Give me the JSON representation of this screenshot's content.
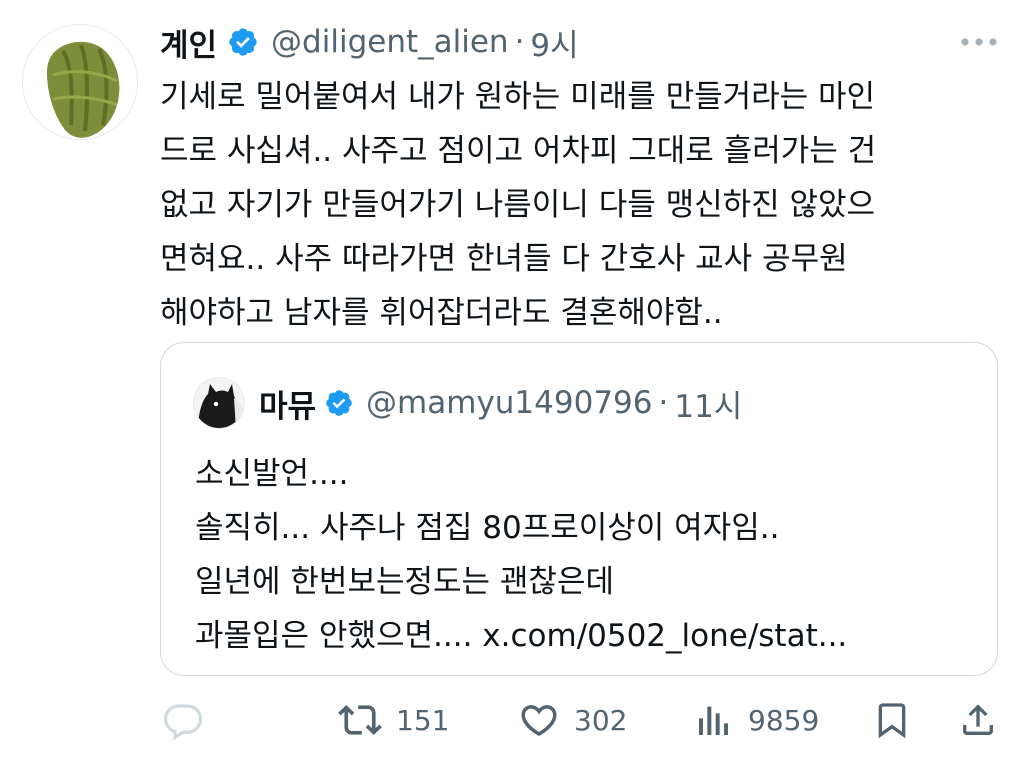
{
  "tweet": {
    "author": {
      "name": "계인",
      "handle": "@diligent_alien",
      "separator": "·",
      "time": "9시",
      "verified": true,
      "avatar": "madeleine-avatar"
    },
    "text_lines": [
      "기세로 밀어붙여서 내가 원하는 미래를 만들거라는 마인",
      "드로 사십셔.. 사주고 점이고 어차피 그대로 흘러가는 건",
      "없고 자기가 만들어가기 나름이니 다들 맹신하진 않았으",
      "면혀요.. 사주 따라가면 한녀들 다 간호사 교사 공무원",
      "해야하고 남자를 휘어잡더라도 결혼해야함.."
    ],
    "quote": {
      "author": {
        "name": "마뮤",
        "handle": "@mamyu1490796",
        "separator": "·",
        "time": "11시",
        "verified": true,
        "avatar": "cat-avatar"
      },
      "text_lines": [
        "소신발언....",
        "솔직히... 사주나 점집 80프로이상이 여자임..",
        "일년에 한번보는정도는 괜찮은데",
        "과몰입은 안했으면.... x.com/0502_lone/stat..."
      ]
    },
    "actions": {
      "reply": {
        "icon": "reply-icon",
        "count": ""
      },
      "retweet": {
        "icon": "retweet-icon",
        "count": "151"
      },
      "like": {
        "icon": "heart-icon",
        "count": "302"
      },
      "views": {
        "icon": "views-icon",
        "count": "9859"
      },
      "bookmark": {
        "icon": "bookmark-icon"
      },
      "share": {
        "icon": "share-icon"
      }
    },
    "colors": {
      "text": "#0f1419",
      "secondary": "#536471",
      "verified_blue": "#1d9bf0",
      "border": "#cfd9de"
    }
  }
}
